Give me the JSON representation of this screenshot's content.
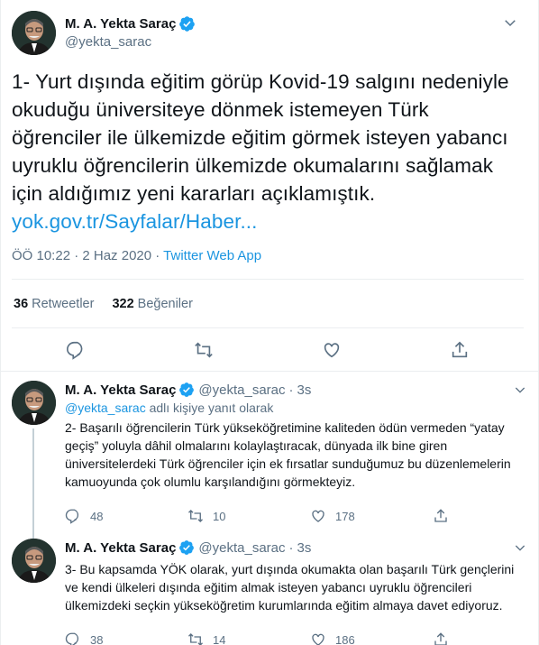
{
  "tweet": {
    "author_name": "M. A. Yekta Saraç",
    "author_handle": "@yekta_sarac",
    "text": "1- Yurt dışında eğitim görüp Kovid-19 salgını nedeniyle okuduğu üniversiteye dönmek istemeyen Türk öğrenciler ile ülkemizde eğitim görmek isteyen yabancı uyruklu öğrencilerin ülkemizde okumalarını sağlamak için aldığımız yeni kararları açıklamıştık.",
    "link": "yok.gov.tr/Sayfalar/Haber...",
    "time": "ÖÖ 10:22 · 2 Haz 2020 · ",
    "app": "Twitter Web App",
    "retweets_count": "36",
    "retweets_label": "Retweetler",
    "likes_count": "322",
    "likes_label": "Beğeniler"
  },
  "replies": [
    {
      "author_name": "M. A. Yekta Saraç",
      "author_handle": "@yekta_sarac",
      "separator": "·",
      "time": "3s",
      "replying_handle": "@yekta_sarac",
      "replying_text": " adlı kişiye yanıt olarak",
      "text": "2- Başarılı öğrencilerin Türk yükseköğretimine kaliteden ödün vermeden “yatay geçiş” yoluyla dâhil olmalarını kolaylaştıracak, dünyada ilk bine giren üniversitelerdeki Türk öğrenciler için ek fırsatlar sunduğumuz bu düzenlemelerin kamuoyunda çok olumlu karşılandığını görmekteyiz.",
      "reply_count": "48",
      "retweet_count": "10",
      "like_count": "178"
    },
    {
      "author_name": "M. A. Yekta Saraç",
      "author_handle": "@yekta_sarac",
      "separator": "·",
      "time": "3s",
      "text": "3- Bu kapsamda YÖK olarak, yurt dışında okumakta olan başarılı Türk gençlerini ve kendi ülkeleri dışında eğitim almak isteyen yabancı uyruklu öğrencileri ülkemizdeki seçkin yükseköğretim kurumlarında eğitim almaya davet ediyoruz.",
      "reply_count": "38",
      "retweet_count": "14",
      "like_count": "186"
    }
  ],
  "colors": {
    "accent": "#1b95e0",
    "muted": "#5b7083",
    "verified": "#1da1f2"
  },
  "icons": [
    "chevron-down-icon",
    "verified-badge-icon",
    "reply-icon",
    "retweet-icon",
    "like-icon",
    "share-icon"
  ]
}
